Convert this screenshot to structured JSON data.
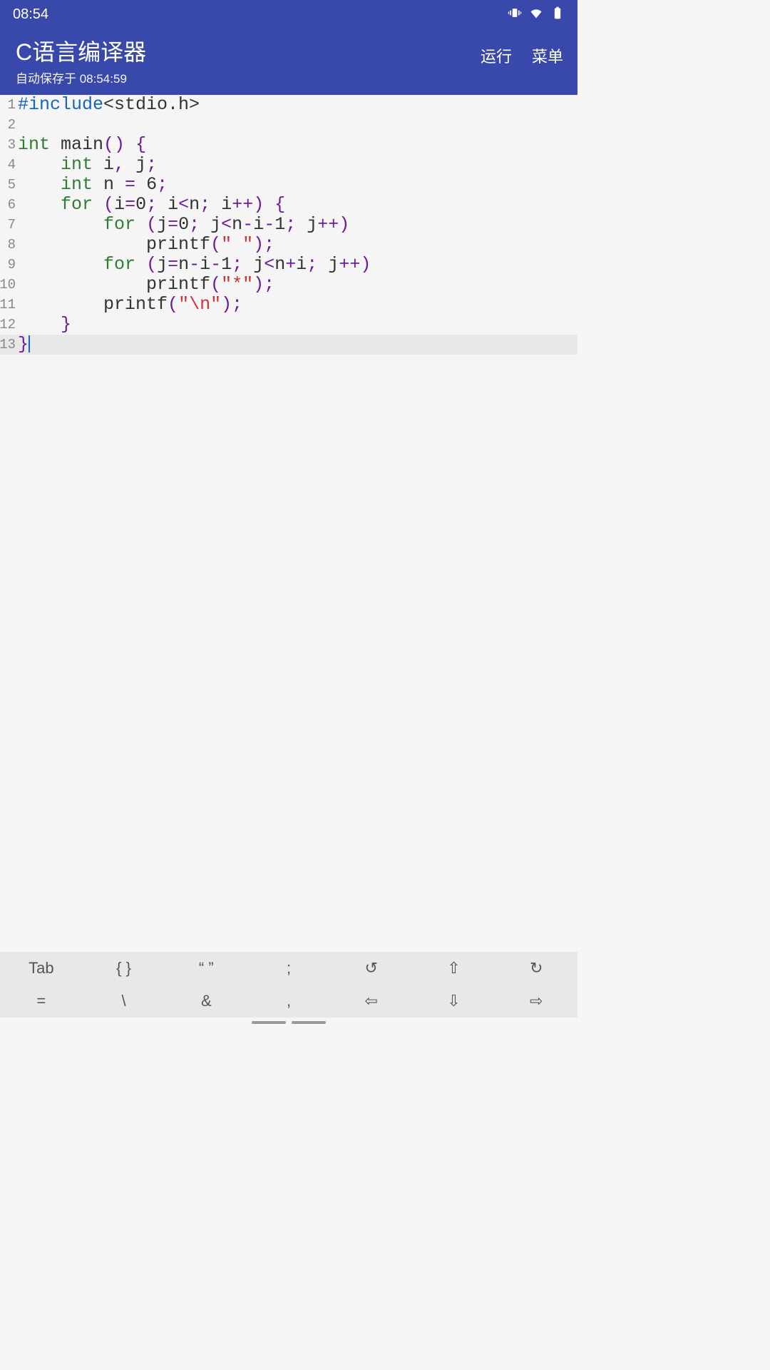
{
  "status": {
    "time": "08:54"
  },
  "header": {
    "title": "C语言编译器",
    "subtitle": "自动保存于 08:54:59",
    "run": "运行",
    "menu": "菜单"
  },
  "code": {
    "lines": [
      [
        {
          "t": "preproc",
          "v": "#include"
        },
        {
          "t": "text",
          "v": "<stdio.h>"
        }
      ],
      [],
      [
        {
          "t": "keyword",
          "v": "int"
        },
        {
          "t": "text",
          "v": " main"
        },
        {
          "t": "punct",
          "v": "()"
        },
        {
          "t": "text",
          "v": " "
        },
        {
          "t": "punct",
          "v": "{"
        }
      ],
      [
        {
          "t": "text",
          "v": "    "
        },
        {
          "t": "keyword",
          "v": "int"
        },
        {
          "t": "text",
          "v": " i"
        },
        {
          "t": "punct",
          "v": ","
        },
        {
          "t": "text",
          "v": " j"
        },
        {
          "t": "punct",
          "v": ";"
        }
      ],
      [
        {
          "t": "text",
          "v": "    "
        },
        {
          "t": "keyword",
          "v": "int"
        },
        {
          "t": "text",
          "v": " n "
        },
        {
          "t": "punct",
          "v": "="
        },
        {
          "t": "text",
          "v": " 6"
        },
        {
          "t": "punct",
          "v": ";"
        }
      ],
      [
        {
          "t": "text",
          "v": "    "
        },
        {
          "t": "keyword",
          "v": "for"
        },
        {
          "t": "text",
          "v": " "
        },
        {
          "t": "punct",
          "v": "("
        },
        {
          "t": "text",
          "v": "i"
        },
        {
          "t": "punct",
          "v": "="
        },
        {
          "t": "text",
          "v": "0"
        },
        {
          "t": "punct",
          "v": ";"
        },
        {
          "t": "text",
          "v": " i"
        },
        {
          "t": "punct",
          "v": "<"
        },
        {
          "t": "text",
          "v": "n"
        },
        {
          "t": "punct",
          "v": ";"
        },
        {
          "t": "text",
          "v": " i"
        },
        {
          "t": "punct",
          "v": "++)"
        },
        {
          "t": "text",
          "v": " "
        },
        {
          "t": "punct",
          "v": "{"
        }
      ],
      [
        {
          "t": "text",
          "v": "        "
        },
        {
          "t": "keyword",
          "v": "for"
        },
        {
          "t": "text",
          "v": " "
        },
        {
          "t": "punct",
          "v": "("
        },
        {
          "t": "text",
          "v": "j"
        },
        {
          "t": "punct",
          "v": "="
        },
        {
          "t": "text",
          "v": "0"
        },
        {
          "t": "punct",
          "v": ";"
        },
        {
          "t": "text",
          "v": " j"
        },
        {
          "t": "punct",
          "v": "<"
        },
        {
          "t": "text",
          "v": "n"
        },
        {
          "t": "punct",
          "v": "-"
        },
        {
          "t": "text",
          "v": "i"
        },
        {
          "t": "punct",
          "v": "-"
        },
        {
          "t": "text",
          "v": "1"
        },
        {
          "t": "punct",
          "v": ";"
        },
        {
          "t": "text",
          "v": " j"
        },
        {
          "t": "punct",
          "v": "++)"
        }
      ],
      [
        {
          "t": "text",
          "v": "            printf"
        },
        {
          "t": "punct",
          "v": "("
        },
        {
          "t": "string",
          "v": "\" \""
        },
        {
          "t": "punct",
          "v": ");"
        }
      ],
      [
        {
          "t": "text",
          "v": "        "
        },
        {
          "t": "keyword",
          "v": "for"
        },
        {
          "t": "text",
          "v": " "
        },
        {
          "t": "punct",
          "v": "("
        },
        {
          "t": "text",
          "v": "j"
        },
        {
          "t": "punct",
          "v": "="
        },
        {
          "t": "text",
          "v": "n"
        },
        {
          "t": "punct",
          "v": "-"
        },
        {
          "t": "text",
          "v": "i"
        },
        {
          "t": "punct",
          "v": "-"
        },
        {
          "t": "text",
          "v": "1"
        },
        {
          "t": "punct",
          "v": ";"
        },
        {
          "t": "text",
          "v": " j"
        },
        {
          "t": "punct",
          "v": "<"
        },
        {
          "t": "text",
          "v": "n"
        },
        {
          "t": "punct",
          "v": "+"
        },
        {
          "t": "text",
          "v": "i"
        },
        {
          "t": "punct",
          "v": ";"
        },
        {
          "t": "text",
          "v": " j"
        },
        {
          "t": "punct",
          "v": "++)"
        }
      ],
      [
        {
          "t": "text",
          "v": "            printf"
        },
        {
          "t": "punct",
          "v": "("
        },
        {
          "t": "string",
          "v": "\"*\""
        },
        {
          "t": "punct",
          "v": ");"
        }
      ],
      [
        {
          "t": "text",
          "v": "        printf"
        },
        {
          "t": "punct",
          "v": "("
        },
        {
          "t": "string",
          "v": "\"\\n\""
        },
        {
          "t": "punct",
          "v": ");"
        }
      ],
      [
        {
          "t": "text",
          "v": "    "
        },
        {
          "t": "punct",
          "v": "}"
        }
      ],
      [
        {
          "t": "punct",
          "v": "}"
        }
      ]
    ],
    "current_line": 13
  },
  "toolbar": {
    "row1": [
      "Tab",
      "{ }",
      "“ ”",
      ";",
      "↺",
      "⇧",
      "↻"
    ],
    "row2": [
      "=",
      "\\",
      "&",
      ",",
      "⇦",
      "⇩",
      "⇨"
    ]
  }
}
